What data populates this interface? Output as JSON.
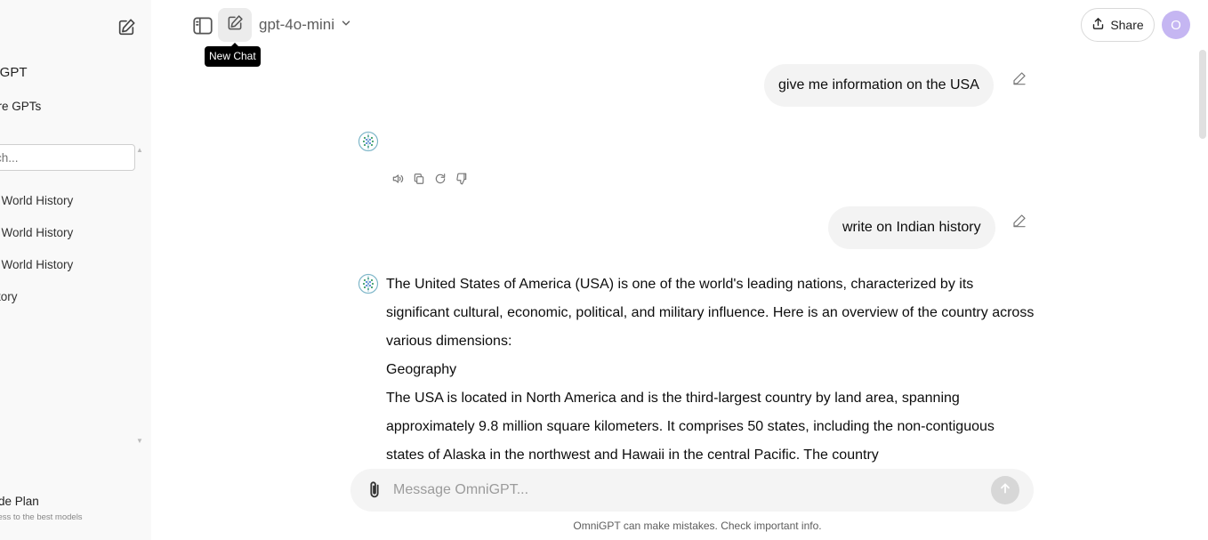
{
  "sidebar": {
    "brand": "niGPT",
    "explore": "ore GPTs",
    "search_placeholder": "ch...",
    "items": [
      {
        "label": "ient World History"
      },
      {
        "label": "ient World History"
      },
      {
        "label": "ient World History"
      },
      {
        "label": "A Story"
      }
    ],
    "upgrade_title": "rade Plan",
    "upgrade_sub": "ccess to the best models"
  },
  "header": {
    "tooltip": "New Chat",
    "model": "gpt-4o-mini",
    "share_label": "Share",
    "avatar_initial": "O"
  },
  "chat": {
    "user_msg_1": "give me information on the USA",
    "user_msg_2": "write on Indian history",
    "answer": {
      "p1": "The United States of America (USA) is one of the world's leading nations, characterized by its significant cultural, economic, political, and military influence. Here is an overview of the country across various dimensions:",
      "heading": "Geography",
      "p2": "The USA is located in North America and is the third-largest country by land area, spanning approximately 9.8 million square kilometers. It comprises 50 states, including the non-contiguous states of Alaska in the northwest and Hawaii in the central Pacific. The country"
    }
  },
  "composer": {
    "placeholder": "Message OmniGPT...",
    "disclaimer": "OmniGPT can make mistakes. Check important info."
  }
}
